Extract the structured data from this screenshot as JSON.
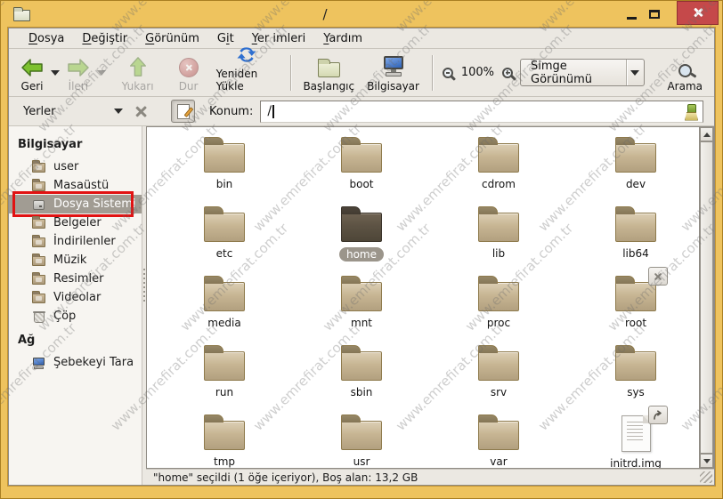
{
  "colors": {
    "titlebar": "#eec35e",
    "close_button": "#c5494a",
    "selection": "#a19c93",
    "annotation": "#e11212",
    "folder_body": "#c7b593",
    "folder_selected": "#5d5344"
  },
  "watermark": {
    "text": "www.emrefirat.com.tr"
  },
  "window": {
    "title": "/"
  },
  "menu": {
    "items": [
      {
        "pre": "",
        "key": "D",
        "post": "osya"
      },
      {
        "pre": "",
        "key": "D",
        "post": "eğiştir"
      },
      {
        "pre": "",
        "key": "G",
        "post": "örünüm"
      },
      {
        "pre": "G",
        "key": "i",
        "post": "t"
      },
      {
        "pre": "",
        "key": "Y",
        "post": "er imleri"
      },
      {
        "pre": "",
        "key": "Y",
        "post": "ardım"
      }
    ]
  },
  "toolbar": {
    "back": "Geri",
    "forward": "İleri",
    "up": "Yukarı",
    "stop": "Dur",
    "reload": "Yeniden Yükle",
    "home": "Başlangıç",
    "computer": "Bilgisayar",
    "zoom_level": "100%",
    "view_mode": "Simge Görünümü",
    "search": "Arama"
  },
  "locationbar": {
    "places_label": "Yerler",
    "location_label": "Konum:",
    "path": "/"
  },
  "sidebar": {
    "sections": [
      {
        "header": "Bilgisayar",
        "items": [
          {
            "label": "user",
            "icon": "home-folder-icon",
            "type": "folder"
          },
          {
            "label": "Masaüstü",
            "icon": "desktop-folder-icon",
            "type": "folder"
          },
          {
            "label": "Dosya Sistemi",
            "icon": "filesystem-drive-icon",
            "type": "drive",
            "selected": true,
            "annotated": true
          },
          {
            "label": "Belgeler",
            "icon": "documents-folder-icon",
            "type": "folder"
          },
          {
            "label": "İndirilenler",
            "icon": "downloads-folder-icon",
            "type": "folder"
          },
          {
            "label": "Müzik",
            "icon": "music-folder-icon",
            "type": "folder"
          },
          {
            "label": "Resimler",
            "icon": "pictures-folder-icon",
            "type": "folder"
          },
          {
            "label": "Videolar",
            "icon": "videos-folder-icon",
            "type": "folder"
          },
          {
            "label": "Çöp",
            "icon": "trash-icon",
            "type": "trash"
          }
        ]
      },
      {
        "header": "Ağ",
        "items": [
          {
            "label": "Şebekeyi Tara",
            "icon": "network-computer-icon",
            "type": "pc"
          }
        ]
      }
    ]
  },
  "files": {
    "items": [
      {
        "label": "bin",
        "type": "folder"
      },
      {
        "label": "boot",
        "type": "folder"
      },
      {
        "label": "cdrom",
        "type": "folder"
      },
      {
        "label": "dev",
        "type": "folder"
      },
      {
        "label": "etc",
        "type": "folder"
      },
      {
        "label": "home",
        "type": "folder",
        "selected": true
      },
      {
        "label": "lib",
        "type": "folder"
      },
      {
        "label": "lib64",
        "type": "folder"
      },
      {
        "label": "media",
        "type": "folder"
      },
      {
        "label": "mnt",
        "type": "folder"
      },
      {
        "label": "proc",
        "type": "folder"
      },
      {
        "label": "root",
        "type": "folder",
        "emblem": "close"
      },
      {
        "label": "run",
        "type": "folder"
      },
      {
        "label": "sbin",
        "type": "folder"
      },
      {
        "label": "srv",
        "type": "folder"
      },
      {
        "label": "sys",
        "type": "folder"
      },
      {
        "label": "tmp",
        "type": "folder"
      },
      {
        "label": "usr",
        "type": "folder"
      },
      {
        "label": "var",
        "type": "folder"
      },
      {
        "label": "initrd.img",
        "type": "file",
        "emblem": "symlink"
      }
    ]
  },
  "statusbar": {
    "text": "\"home\" seçildi (1 öğe içeriyor), Boş alan: 13,2 GB"
  }
}
